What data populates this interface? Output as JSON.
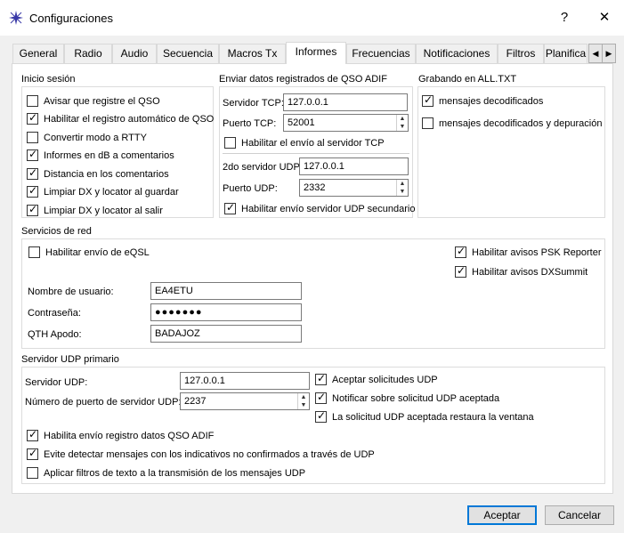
{
  "window": {
    "title": "Configuraciones",
    "help_label": "?",
    "close_label": "✕"
  },
  "tabs": [
    "General",
    "Radio",
    "Audio",
    "Secuencia",
    "Macros Tx",
    "Informes",
    "Frecuencias",
    "Notificaciones",
    "Filtros",
    "Planifica"
  ],
  "active_tab": "Informes",
  "tab_scroll": {
    "left": "◀",
    "right": "▶"
  },
  "inicio": {
    "title": "Inicio sesión",
    "items": [
      {
        "label": "Avisar que registre el QSO",
        "checked": false
      },
      {
        "label": "Habilitar el registro automático de QSO",
        "checked": true
      },
      {
        "label": "Convertir modo a RTTY",
        "checked": false
      },
      {
        "label": "Informes en dB a comentarios",
        "checked": true
      },
      {
        "label": "Distancia en los comentarios",
        "checked": true
      },
      {
        "label": "Limpiar DX y locator al guardar",
        "checked": true
      },
      {
        "label": "Limpiar DX y locator al salir",
        "checked": true
      }
    ]
  },
  "adif": {
    "title": "Enviar datos registrados de QSO ADIF",
    "tcp_server_label": "Servidor TCP:",
    "tcp_server_value": "127.0.0.1",
    "tcp_port_label": "Puerto TCP:",
    "tcp_port_value": "52001",
    "tcp_enable_label": "Habilitar el envío al servidor TCP",
    "tcp_enable_checked": false,
    "udp2_server_label": "2do servidor UDP",
    "udp2_server_value": "127.0.0.1",
    "udp_port_label": "Puerto UDP:",
    "udp_port_value": "2332",
    "udp2_enable_label": "Habilitar envío servidor UDP secundario",
    "udp2_enable_checked": true
  },
  "alltxt": {
    "title": "Grabando en ALL.TXT",
    "items": [
      {
        "label": "mensajes decodificados",
        "checked": true
      },
      {
        "label": "mensajes decodificados y depuración",
        "checked": false
      }
    ]
  },
  "network": {
    "title": "Servicios de red",
    "eqsl_label": "Habilitar envío de eQSL",
    "eqsl_checked": false,
    "psk_label": "Habilitar avisos PSK Reporter",
    "psk_checked": true,
    "dxsummit_label": "Habilitar avisos DXSummit",
    "dxsummit_checked": true,
    "username_label": "Nombre de usuario:",
    "username_value": "EA4ETU",
    "password_label": "Contraseña:",
    "password_value": "●●●●●●●",
    "qth_label": "QTH Apodo:",
    "qth_value": "BADAJOZ"
  },
  "udp_primary": {
    "title": "Servidor UDP primario",
    "server_label": "Servidor UDP:",
    "server_value": "127.0.0.1",
    "port_label": "Número de puerto de servidor UDP:",
    "port_value": "2237",
    "right_items": [
      {
        "label": "Aceptar solicitudes UDP",
        "checked": true
      },
      {
        "label": "Notificar sobre solicitud UDP aceptada",
        "checked": true
      },
      {
        "label": "La solicitud UDP aceptada restaura la ventana",
        "checked": true
      }
    ],
    "bottom_items": [
      {
        "label": "Habilita envío registro datos QSO ADIF",
        "checked": true
      },
      {
        "label": "Evite detectar mensajes con los indicativos no confirmados a través de UDP",
        "checked": true
      },
      {
        "label": "Aplicar filtros de texto a la transmisión de los mensajes UDP",
        "checked": false
      }
    ]
  },
  "buttons": {
    "accept": "Aceptar",
    "cancel": "Cancelar"
  },
  "colors": {
    "accent": "#0078d7",
    "icon": "#3a3aa8"
  }
}
